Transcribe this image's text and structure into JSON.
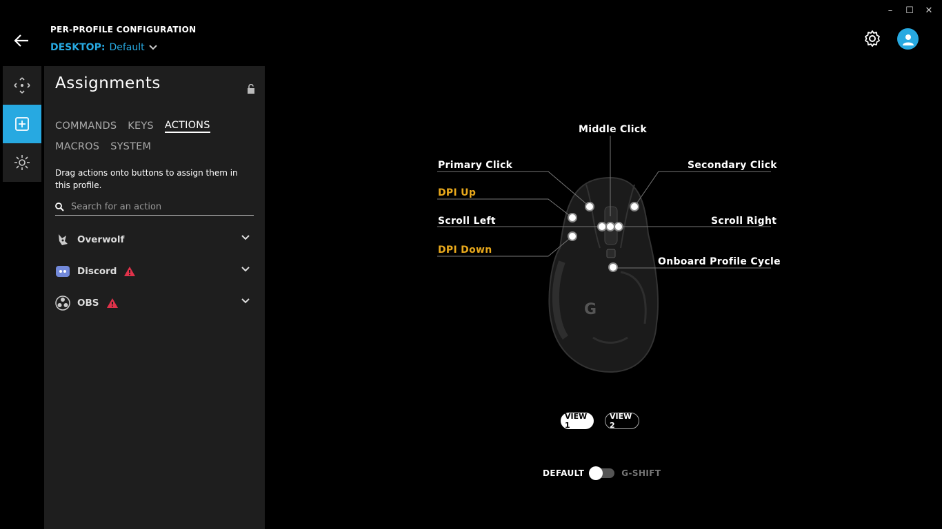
{
  "window": {
    "minimize": "–",
    "maximize": "☐",
    "close": "✕"
  },
  "header": {
    "title": "PER-PROFILE CONFIGURATION",
    "profile_group": "DESKTOP:",
    "profile_name": "Default"
  },
  "rail": {
    "items": [
      {
        "icon": "move-arrows-icon"
      },
      {
        "icon": "plus-square-icon",
        "active": true
      },
      {
        "icon": "light-sun-icon"
      }
    ]
  },
  "panel": {
    "title": "Assignments",
    "tabs_row1": [
      "COMMANDS",
      "KEYS",
      "ACTIONS"
    ],
    "tabs_row2": [
      "MACROS",
      "SYSTEM"
    ],
    "active_tab": "ACTIONS",
    "hint": "Drag actions onto buttons to assign them in this profile.",
    "search_placeholder": "Search for an action",
    "groups": [
      {
        "name": "Overwolf",
        "icon": "overwolf-icon",
        "warning": false
      },
      {
        "name": "Discord",
        "icon": "discord-icon",
        "warning": true
      },
      {
        "name": "OBS",
        "icon": "obs-icon",
        "warning": true
      }
    ]
  },
  "mouse": {
    "labels": {
      "middle": "Middle Click",
      "primary": "Primary Click",
      "secondary": "Secondary Click",
      "dpi_up": "DPI Up",
      "scroll_left": "Scroll Left",
      "scroll_right": "Scroll Right",
      "dpi_down": "DPI Down",
      "onboard": "Onboard Profile Cycle"
    },
    "highlight_color": "#e9a91c"
  },
  "views": {
    "view1": "VIEW 1",
    "view2": "VIEW 2",
    "active": "VIEW 1"
  },
  "mode": {
    "default": "DEFAULT",
    "gshift": "G-SHIFT",
    "gshift_enabled": false
  },
  "colors": {
    "accent": "#27a9e1",
    "warning": "#e0324a"
  }
}
